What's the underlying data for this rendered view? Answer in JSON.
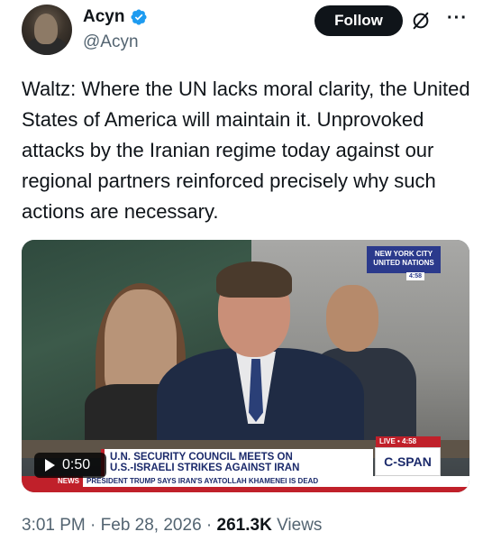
{
  "author": {
    "display_name": "Acyn",
    "handle": "@Acyn",
    "verified": true
  },
  "actions": {
    "follow_label": "Follow",
    "grok_icon": "grok-icon",
    "more_icon": "more-icon"
  },
  "tweet": {
    "text": "Waltz: Where the UN lacks moral clarity, the United States of America will maintain it. Unprovoked attacks by the Iranian regime today against our regional partners reinforced precisely why such actions are necessary."
  },
  "video": {
    "duration": "0:50",
    "location_badge_line1": "NEW YORK CITY",
    "location_badge_line2": "UNITED NATIONS",
    "location_time": "4:58",
    "live_label": "LIVE • 4:58",
    "headline_line1": "U.N. SECURITY COUNCIL MEETS ON",
    "headline_line2": "U.S.-ISRAELI STRIKES AGAINST IRAN",
    "network": "C-SPAN",
    "news_tag": "NEWS",
    "ticker": "PRESIDENT TRUMP SAYS IRAN'S AYATOLLAH KHAMENEI IS DEAD"
  },
  "meta": {
    "time": "3:01 PM",
    "separator": "·",
    "date": "Feb 28, 2026",
    "views_count": "261.3K",
    "views_label": "Views"
  },
  "colors": {
    "brand_blue": "#1d9bf0",
    "text_primary": "#0f1419",
    "text_secondary": "#536471",
    "cspan_blue": "#1b2a6b",
    "cspan_red": "#c0202a"
  }
}
